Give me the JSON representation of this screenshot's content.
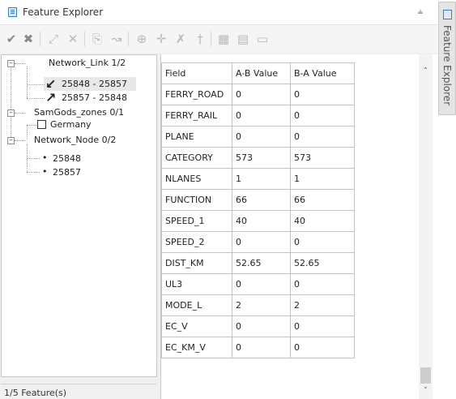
{
  "window": {
    "title": "Feature Explorer"
  },
  "side_tab": {
    "label": "Feature Explorer"
  },
  "toolbar": {
    "icons": [
      "checkmark-icon",
      "cancel-icon",
      "expand-icon",
      "close-icon",
      "copy-icon",
      "pan-icon",
      "add-node-icon",
      "move-node-icon",
      "delete-node-icon",
      "split-icon",
      "grid-icon",
      "table-icon",
      "folder-icon"
    ]
  },
  "tree": {
    "groups": [
      {
        "label": "Network_Link 1/2",
        "items": [
          {
            "label": "25848 - 25857",
            "selected": true
          },
          {
            "label": "25857 - 25848"
          }
        ]
      },
      {
        "label": "SamGods_zones 0/1",
        "items": [
          {
            "label": "Germany"
          }
        ]
      },
      {
        "label": "Network_Node 0/2",
        "items": [
          {
            "label": "25848"
          },
          {
            "label": "25857"
          }
        ]
      }
    ]
  },
  "status": {
    "text": "1/5 Feature(s)"
  },
  "grid": {
    "headers": [
      "Field",
      "A-B Value",
      "B-A Value"
    ],
    "rows": [
      [
        "FERRY_ROAD",
        "0",
        "0"
      ],
      [
        "FERRY_RAIL",
        "0",
        "0"
      ],
      [
        "PLANE",
        "0",
        "0"
      ],
      [
        "CATEGORY",
        "573",
        "573"
      ],
      [
        "NLANES",
        "1",
        "1"
      ],
      [
        "FUNCTION",
        "66",
        "66"
      ],
      [
        "SPEED_1",
        "40",
        "40"
      ],
      [
        "SPEED_2",
        "0",
        "0"
      ],
      [
        "DIST_KM",
        "52.65",
        "52.65"
      ],
      [
        "UL3",
        "0",
        "0"
      ],
      [
        "MODE_L",
        "2",
        "2"
      ],
      [
        "EC_V",
        "0",
        "0"
      ],
      [
        "EC_KM_V",
        "0",
        "0"
      ]
    ]
  }
}
